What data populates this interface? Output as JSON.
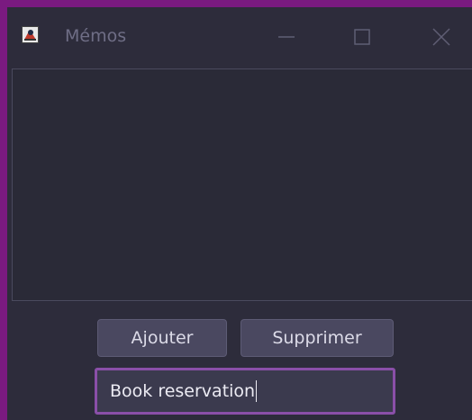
{
  "window": {
    "title": "Mémos",
    "icons": {
      "app": "app-logo-icon",
      "minimize": "minimize-icon",
      "maximize": "maximize-icon",
      "close": "close-icon"
    }
  },
  "buttons": {
    "add_label": "Ajouter",
    "delete_label": "Supprimer"
  },
  "memo_input": {
    "value": "Book reservation"
  },
  "colors": {
    "border_accent": "#7a1a80",
    "window_bg": "#2d2c3b",
    "input_focus": "#8a4fa8"
  }
}
